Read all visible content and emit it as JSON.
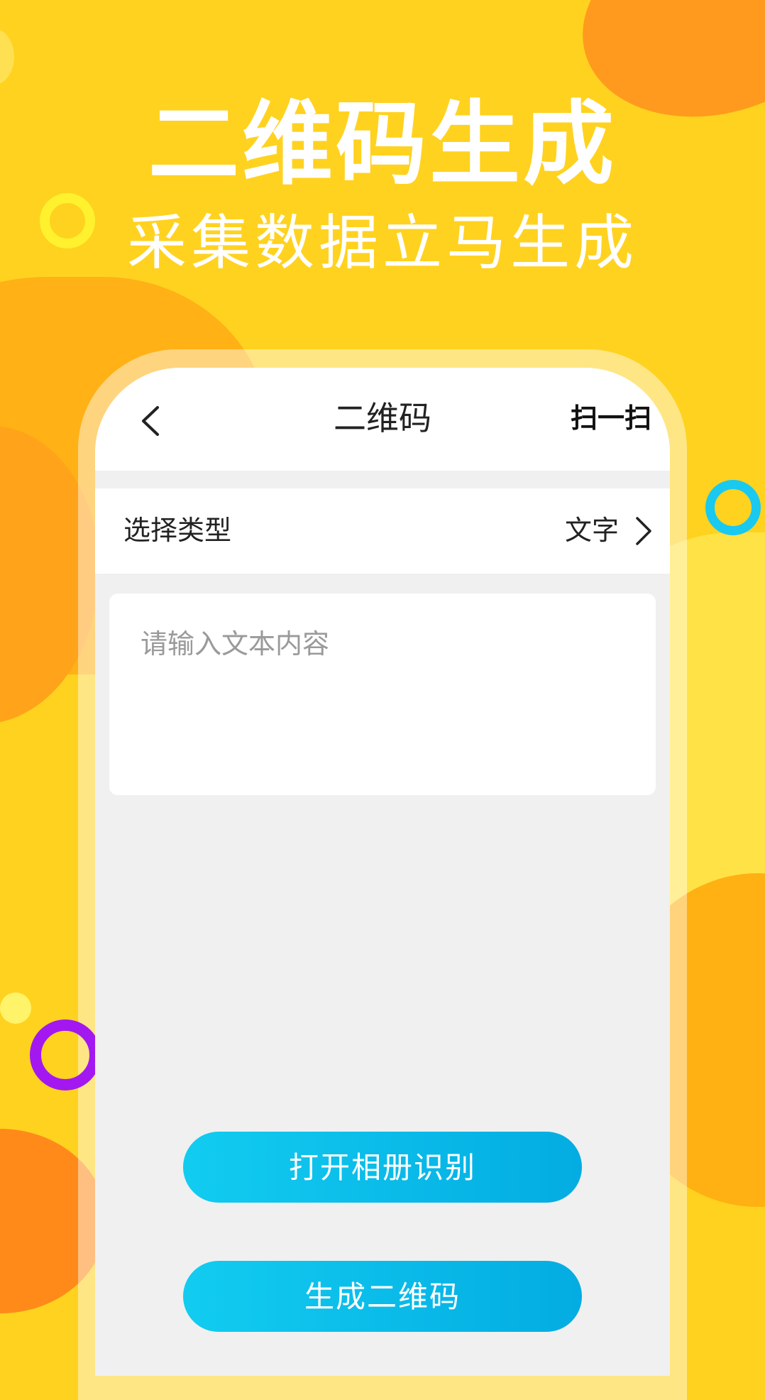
{
  "promo": {
    "headline": "二维码生成",
    "subline": "采集数据立马生成"
  },
  "navbar": {
    "back_icon": "chevron-left-icon",
    "title": "二维码",
    "scan_label": "扫一扫"
  },
  "type_row": {
    "label": "选择类型",
    "value": "文字",
    "icon": "chevron-right-icon"
  },
  "input": {
    "value": "",
    "placeholder": "请输入文本内容"
  },
  "buttons": {
    "open_album": "打开相册识别",
    "generate": "生成二维码"
  },
  "colors": {
    "background": "#FFD21F",
    "accent_blue": "#03ACE2",
    "ring_yellow": "#FFF12E",
    "ring_blue": "#19C9F0",
    "ring_purple": "#A318F0"
  }
}
